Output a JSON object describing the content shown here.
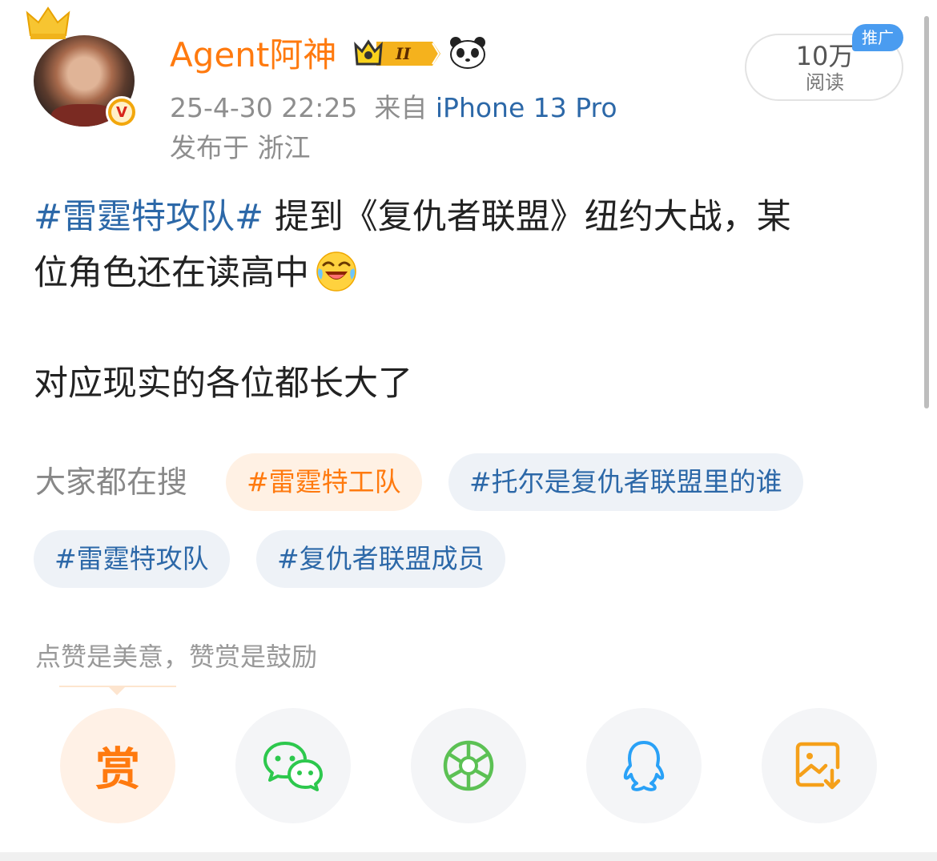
{
  "user": {
    "name": "Agent阿神",
    "timestamp": "25-4-30 22:25",
    "source_prefix": "来自",
    "source_device": "iPhone 13 Pro",
    "location": "发布于 浙江",
    "level_badge_text": "II"
  },
  "stats": {
    "reads_count": "10万",
    "reads_label": "阅读",
    "promo_tag": "推广"
  },
  "post": {
    "hashtag": "#雷霆特攻队#",
    "text_line1": " 提到《复仇者联盟》纽约大战，某",
    "text_line2": "位角色还在读高中",
    "paragraph2": "对应现实的各位都长大了"
  },
  "search": {
    "label": "大家都在搜",
    "chips": [
      "#雷霆特工队",
      "#托尔是复仇者联盟里的谁",
      "#雷霆特攻队",
      "#复仇者联盟成员"
    ]
  },
  "reward": {
    "prompt": "点赞是美意，赞赏是鼓励",
    "button_char": "赏"
  },
  "share_icons": [
    "reward-icon",
    "wechat-icon",
    "moments-icon",
    "qq-icon",
    "save-image-icon"
  ],
  "colors": {
    "accent_orange": "#ff7a0f",
    "link_blue": "#2c68a8",
    "meta_gray": "#8e8e8e",
    "wechat_green": "#2dc84d",
    "moments_green": "#5cc154",
    "qq_blue": "#29a1f7",
    "promo_blue": "#4a9cf0"
  }
}
